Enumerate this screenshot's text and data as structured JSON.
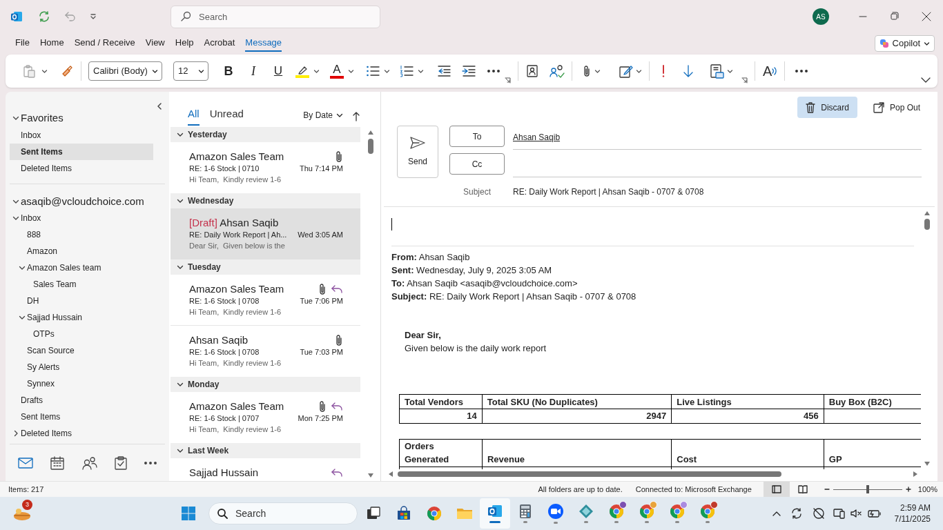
{
  "title_bar": {
    "search_placeholder": "Search",
    "avatar": "AS"
  },
  "menu_tabs": [
    {
      "label": "File",
      "selected": false
    },
    {
      "label": "Home",
      "selected": false
    },
    {
      "label": "Send / Receive",
      "selected": false
    },
    {
      "label": "View",
      "selected": false
    },
    {
      "label": "Help",
      "selected": false
    },
    {
      "label": "Acrobat",
      "selected": false
    },
    {
      "label": "Message",
      "selected": true
    }
  ],
  "copilot": "Copilot",
  "ribbon": {
    "font": "Calibri (Body)",
    "font_size": "12",
    "bold": "B",
    "italic": "I",
    "underline": "U",
    "font_color": "A",
    "read_aloud": "A"
  },
  "folder_pane": {
    "favorites": {
      "label": "Favorites",
      "expanded": true,
      "items": [
        {
          "label": "Inbox",
          "selected": false
        },
        {
          "label": "Sent Items",
          "selected": true
        },
        {
          "label": "Deleted Items",
          "selected": false
        }
      ]
    },
    "account": {
      "label": "asaqib@vcloudchoice.com",
      "expanded": true,
      "folders": [
        {
          "label": "Inbox",
          "selected": false,
          "expanded": true,
          "children": [
            {
              "label": "888",
              "selected": false
            },
            {
              "label": "Amazon",
              "selected": false
            },
            {
              "label": "Amazon Sales team",
              "selected": false,
              "expanded": true,
              "children": [
                {
                  "label": "Sales Team",
                  "selected": false
                }
              ]
            },
            {
              "label": "DH",
              "selected": false
            },
            {
              "label": "Sajjad Hussain",
              "selected": false,
              "expanded": true,
              "children": [
                {
                  "label": "OTPs",
                  "selected": false
                }
              ]
            },
            {
              "label": "Scan Source",
              "selected": false
            },
            {
              "label": "Sy Alerts",
              "selected": false
            },
            {
              "label": "Synnex",
              "selected": false
            }
          ]
        },
        {
          "label": "Drafts",
          "selected": false
        },
        {
          "label": "Sent Items",
          "selected": false
        },
        {
          "label": "Deleted Items",
          "selected": false,
          "expanded": false
        }
      ]
    },
    "nav": [
      {
        "kind": "mail",
        "selected": true
      },
      {
        "kind": "calendar",
        "selected": false
      },
      {
        "kind": "people",
        "selected": false
      },
      {
        "kind": "tasks",
        "selected": false
      },
      {
        "kind": "more",
        "selected": false
      }
    ]
  },
  "message_list": {
    "filters": [
      {
        "label": "All",
        "selected": true
      },
      {
        "label": "Unread",
        "selected": false
      }
    ],
    "sort": "By Date",
    "groups": [
      {
        "label": "Yesterday",
        "expanded": true,
        "messages": [
          {
            "sender": "Amazon Sales Team",
            "subject": "RE: 1-6 Stock | 0710",
            "time": "Thu 7:14 PM",
            "preview": "Hi Team,  Kindly review 1-6",
            "attachment": true,
            "replied": false,
            "selected": false
          }
        ]
      },
      {
        "label": "Wednesday",
        "expanded": true,
        "messages": [
          {
            "draft_tag": "[Draft]",
            "sender": "Ahsan Saqib",
            "subject": "RE: Daily Work Report | Ah...",
            "time": "Wed 3:05 AM",
            "preview": "Dear Sir,  Given below is the",
            "attachment": false,
            "replied": false,
            "selected": true
          }
        ]
      },
      {
        "label": "Tuesday",
        "expanded": true,
        "messages": [
          {
            "sender": "Amazon Sales Team",
            "subject": "RE: 1-6 Stock | 0708",
            "time": "Tue 7:06 PM",
            "preview": "Hi Team,  Kindly review 1-6",
            "attachment": true,
            "replied": true,
            "selected": false
          },
          {
            "sender": "Ahsan Saqib",
            "subject": "RE: 1-6 Stock | 0708",
            "time": "Tue 7:03 PM",
            "preview": "Hi Team,  Kindly review 1-6",
            "attachment": true,
            "replied": false,
            "selected": false
          }
        ]
      },
      {
        "label": "Monday",
        "expanded": true,
        "messages": [
          {
            "sender": "Amazon Sales Team",
            "subject": "RE: 1-6 Stock | 0707",
            "time": "Mon 7:25 PM",
            "preview": "Hi Team,  Kindly review 1-6",
            "attachment": true,
            "replied": true,
            "selected": false
          }
        ]
      },
      {
        "label": "Last Week",
        "expanded": true,
        "messages": [
          {
            "sender": "Sajjad Hussain",
            "attachment": false,
            "replied": true,
            "selected": false
          }
        ]
      }
    ]
  },
  "reading_pane": {
    "actions": [
      {
        "kind": "discard",
        "label": "Discard",
        "selected": true
      },
      {
        "kind": "pop_out",
        "label": "Pop Out",
        "selected": false
      }
    ],
    "send": "Send",
    "to_label": "To",
    "to": "Ahsan Saqib",
    "cc_label": "Cc",
    "subject_label": "Subject",
    "subject": "RE: Daily Work Report | Ahsan Saqib - 0707 & 0708",
    "quoted_header": [
      "**From:** Ahsan Saqib",
      "**Sent:** Wednesday, July 9, 2025 3:05 AM",
      "**To:** Ahsan Saqib <asaqib@vcloudchoice.com>",
      "**Subject:** RE: Daily Work Report | Ahsan Saqib - 0707 & 0708"
    ],
    "greeting": "Dear Sir,",
    "intro": "Given below is the daily work report",
    "tables": [
      {
        "header": [
          "Total Vendors",
          "Total SKU (No Duplicates)",
          "Live Listings",
          "Buy Box (B2C)"
        ],
        "rows": [
          [
            "14",
            "2947",
            "456"
          ]
        ]
      },
      {
        "header": [
          "Orders Generated",
          "Revenue",
          "Cost",
          "GP"
        ]
      }
    ]
  },
  "status_bar": {
    "items": "Items: 217",
    "sync": "All folders are up to date.",
    "connection": "Connected to: Microsoft Exchange",
    "views": [
      {
        "kind": "normal",
        "selected": true
      },
      {
        "kind": "reading",
        "selected": false
      }
    ],
    "zoom": {
      "level": 0.5,
      "label": "100%"
    }
  },
  "taskbar": {
    "widget_badge": "3",
    "search_placeholder": "Search",
    "apps": [
      {
        "kind": "task_view",
        "running": false,
        "selected": false
      },
      {
        "kind": "store",
        "running": false,
        "selected": false
      },
      {
        "kind": "chrome",
        "running": false,
        "selected": false
      },
      {
        "kind": "folder",
        "running": false,
        "selected": false
      },
      {
        "kind": "outlook",
        "running": true,
        "selected": true
      },
      {
        "kind": "calculator",
        "running": true,
        "selected": false
      },
      {
        "kind": "zoom",
        "running": true,
        "selected": false
      },
      {
        "kind": "gem",
        "running": true,
        "selected": false
      },
      {
        "kind": "chrome",
        "running": true,
        "selected": false,
        "color": "#7b4fb0"
      },
      {
        "kind": "chrome",
        "running": true,
        "selected": false,
        "color": "#e8a33b"
      },
      {
        "kind": "chrome",
        "running": true,
        "selected": false,
        "color": "#a98be0"
      },
      {
        "kind": "chrome",
        "running": true,
        "selected": false,
        "color": "#c0392b"
      }
    ],
    "time": "2:59 AM",
    "date": "7/11/2025"
  }
}
